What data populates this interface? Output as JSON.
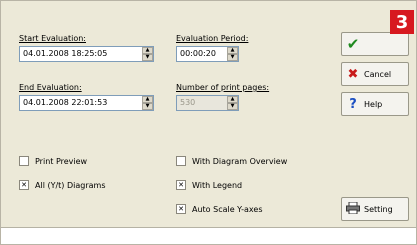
{
  "form": {
    "start_label": "Start Evaluation:",
    "start_value": "04.01.2008 18:25:05",
    "end_label": "End Evaluation:",
    "end_value": "04.01.2008 22:01:53",
    "period_label": "Evaluation Period:",
    "period_value": "00:00:20",
    "pages_label": "Number of print pages:",
    "pages_value": "530"
  },
  "options": {
    "print_preview": {
      "label": "Print Preview",
      "checked": false
    },
    "all_diagrams": {
      "label": "All (Y/t) Diagrams",
      "checked": true
    },
    "diagram_overview": {
      "label": "With Diagram Overview",
      "checked": false
    },
    "legend": {
      "label": "With Legend",
      "checked": true
    },
    "auto_scale": {
      "label": "Auto Scale Y-axes",
      "checked": true
    }
  },
  "buttons": {
    "ok_icon": "checkmark-icon",
    "cancel_label": "Cancel",
    "help_label": "Help",
    "setting_label": "Setting"
  },
  "badge": "3",
  "colors": {
    "badge": "#d71920",
    "dialog_bg": "#ece9d8",
    "ok_icon": "#1f8a1f",
    "cancel_icon": "#c81a1a",
    "help_icon": "#1b4fc2"
  }
}
